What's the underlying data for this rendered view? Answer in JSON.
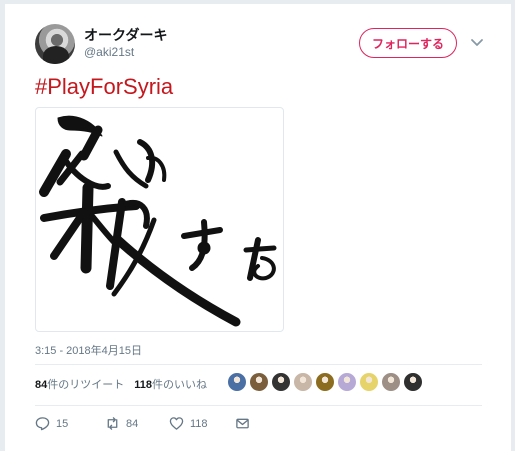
{
  "tweet": {
    "author": {
      "display_name": "オークダーキ",
      "handle": "@aki21st"
    },
    "follow_label": "フォローする",
    "text": "#PlayForSyria",
    "timestamp": "3:15 - 2018年4月15日",
    "stats": {
      "retweet_count": "84",
      "retweet_label": "件のリツイート",
      "like_count": "118",
      "like_label": "件のいいね"
    },
    "actions": {
      "reply_count": "15",
      "retweet_count": "84",
      "like_count": "118"
    },
    "likers": [
      {
        "name": "liker-1",
        "color": "#4a6fa5"
      },
      {
        "name": "liker-2",
        "color": "#7b5e3c"
      },
      {
        "name": "liker-3",
        "color": "#333333"
      },
      {
        "name": "liker-4",
        "color": "#c8b6a6"
      },
      {
        "name": "liker-5",
        "color": "#8c6d1f"
      },
      {
        "name": "liker-6",
        "color": "#b7a9d6"
      },
      {
        "name": "liker-7",
        "color": "#e6d36a"
      },
      {
        "name": "liker-8",
        "color": "#9d8f85"
      },
      {
        "name": "liker-9",
        "color": "#2f2f2f"
      }
    ],
    "colors": {
      "accent": "#e0245e",
      "hashtag": "#c4181e",
      "muted": "#657786"
    }
  }
}
